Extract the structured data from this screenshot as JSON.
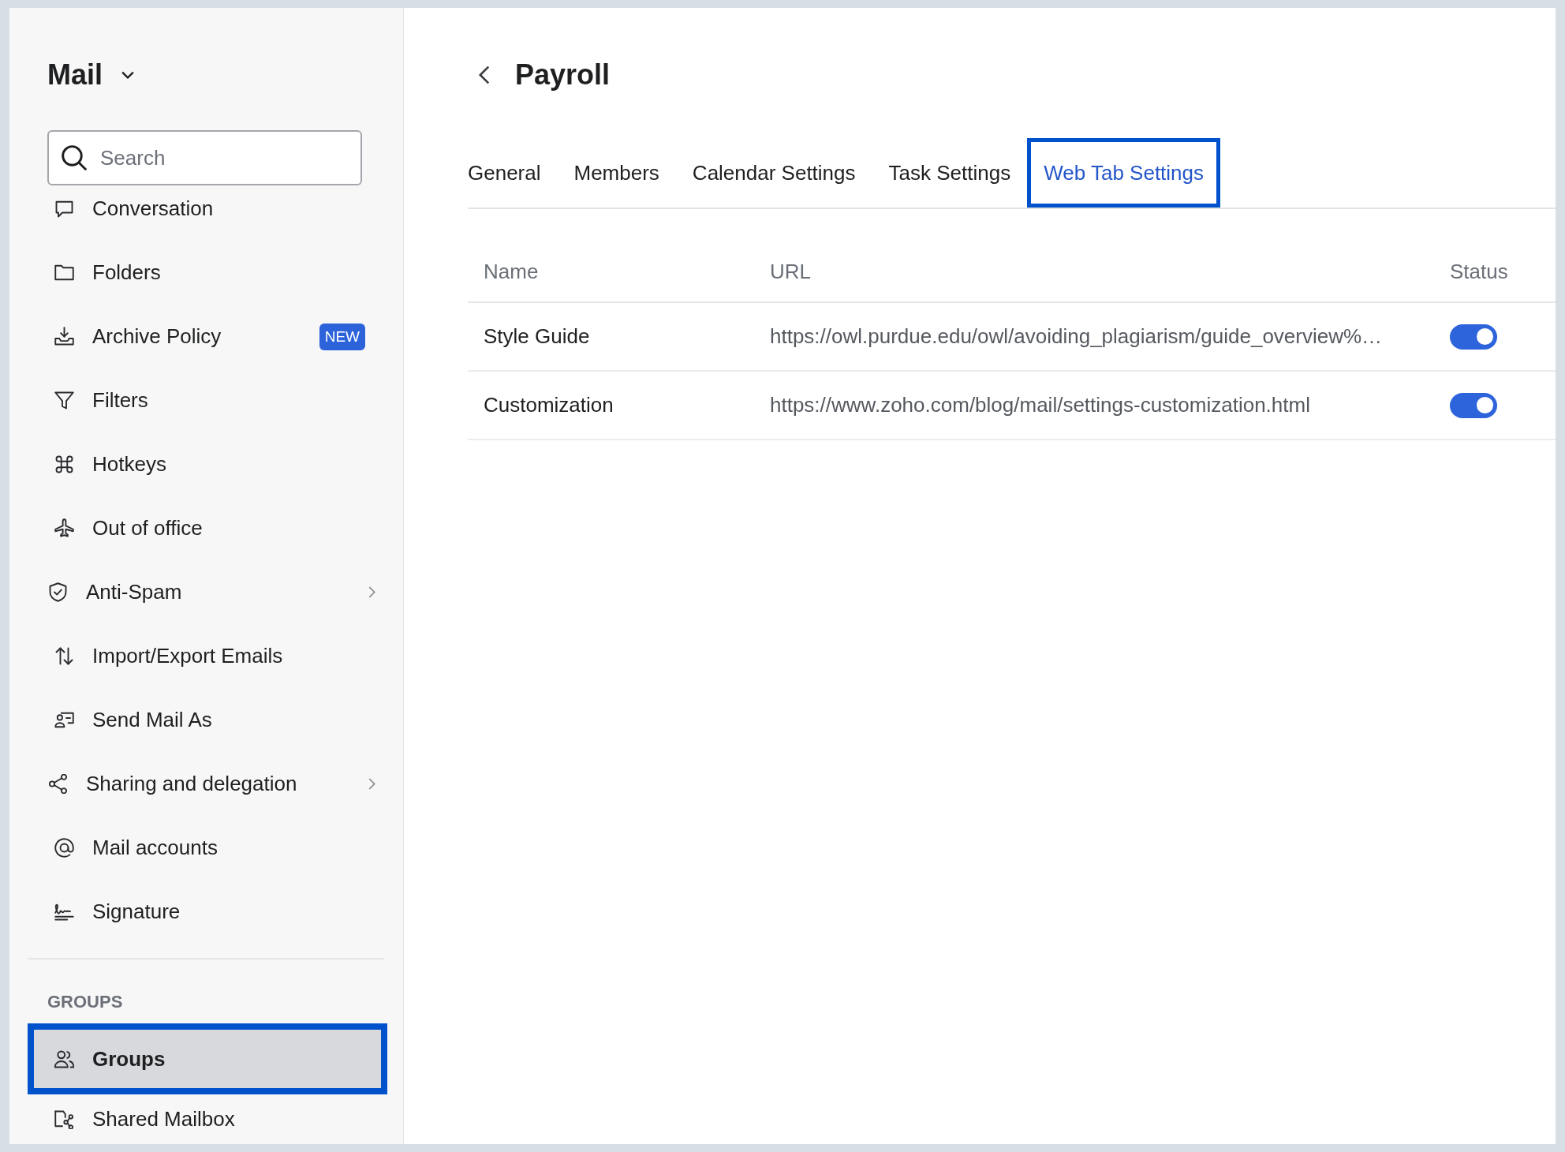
{
  "sidebar": {
    "title": "Mail",
    "search": {
      "placeholder": "Search"
    },
    "items": [
      {
        "label": "Conversation",
        "selected": false,
        "submenu": false
      },
      {
        "label": "Folders",
        "selected": false,
        "submenu": false
      },
      {
        "label": "Archive Policy",
        "badge": "NEW",
        "selected": false,
        "submenu": false
      },
      {
        "label": "Filters",
        "selected": false,
        "submenu": false
      },
      {
        "label": "Hotkeys",
        "selected": false,
        "submenu": false
      },
      {
        "label": "Out of office",
        "selected": false,
        "submenu": false
      },
      {
        "label": "Anti-Spam",
        "selected": false,
        "submenu": true
      },
      {
        "label": "Import/Export Emails",
        "selected": false,
        "submenu": false
      },
      {
        "label": "Send Mail As",
        "selected": false,
        "submenu": false
      },
      {
        "label": "Sharing and delegation",
        "selected": false,
        "submenu": true
      },
      {
        "label": "Mail accounts",
        "selected": false,
        "submenu": false
      },
      {
        "label": "Signature",
        "selected": false,
        "submenu": false
      }
    ],
    "groups": {
      "heading": "GROUPS",
      "items": [
        {
          "label": "Groups",
          "selected": true
        },
        {
          "label": "Shared Mailbox",
          "selected": false
        }
      ]
    }
  },
  "page": {
    "title": "Payroll"
  },
  "tabs": [
    {
      "label": "General",
      "selected": false
    },
    {
      "label": "Members",
      "selected": false
    },
    {
      "label": "Calendar Settings",
      "selected": false
    },
    {
      "label": "Task Settings",
      "selected": false
    },
    {
      "label": "Web Tab Settings",
      "selected": true
    }
  ],
  "table": {
    "columns": [
      "Name",
      "URL",
      "Status"
    ],
    "rows": [
      {
        "name": "Style Guide",
        "url": "https://owl.purdue.edu/owl/avoiding_plagiarism/guide_overview%…",
        "enabled": true
      },
      {
        "name": "Customization",
        "url": "https://www.zoho.com/blog/mail/settings-customization.html",
        "enabled": true
      }
    ]
  }
}
